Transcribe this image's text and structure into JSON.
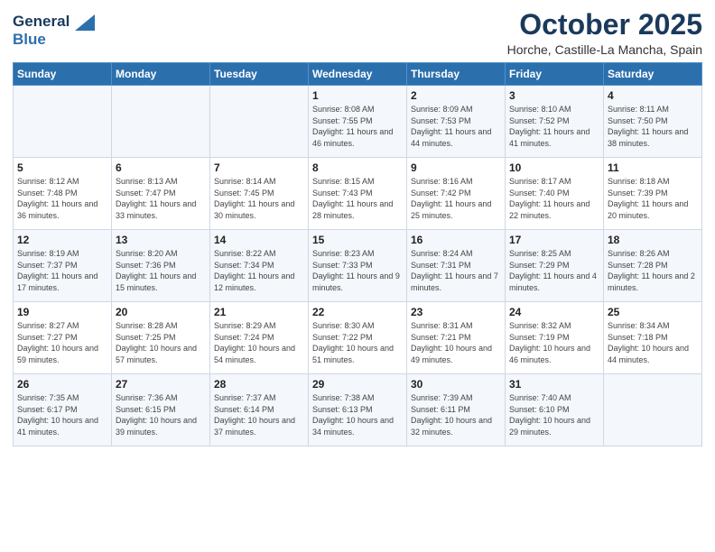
{
  "header": {
    "logo_line1": "General",
    "logo_line2": "Blue",
    "month": "October 2025",
    "location": "Horche, Castille-La Mancha, Spain"
  },
  "weekdays": [
    "Sunday",
    "Monday",
    "Tuesday",
    "Wednesday",
    "Thursday",
    "Friday",
    "Saturday"
  ],
  "weeks": [
    [
      {
        "day": "",
        "info": ""
      },
      {
        "day": "",
        "info": ""
      },
      {
        "day": "",
        "info": ""
      },
      {
        "day": "1",
        "info": "Sunrise: 8:08 AM\nSunset: 7:55 PM\nDaylight: 11 hours and 46 minutes."
      },
      {
        "day": "2",
        "info": "Sunrise: 8:09 AM\nSunset: 7:53 PM\nDaylight: 11 hours and 44 minutes."
      },
      {
        "day": "3",
        "info": "Sunrise: 8:10 AM\nSunset: 7:52 PM\nDaylight: 11 hours and 41 minutes."
      },
      {
        "day": "4",
        "info": "Sunrise: 8:11 AM\nSunset: 7:50 PM\nDaylight: 11 hours and 38 minutes."
      }
    ],
    [
      {
        "day": "5",
        "info": "Sunrise: 8:12 AM\nSunset: 7:48 PM\nDaylight: 11 hours and 36 minutes."
      },
      {
        "day": "6",
        "info": "Sunrise: 8:13 AM\nSunset: 7:47 PM\nDaylight: 11 hours and 33 minutes."
      },
      {
        "day": "7",
        "info": "Sunrise: 8:14 AM\nSunset: 7:45 PM\nDaylight: 11 hours and 30 minutes."
      },
      {
        "day": "8",
        "info": "Sunrise: 8:15 AM\nSunset: 7:43 PM\nDaylight: 11 hours and 28 minutes."
      },
      {
        "day": "9",
        "info": "Sunrise: 8:16 AM\nSunset: 7:42 PM\nDaylight: 11 hours and 25 minutes."
      },
      {
        "day": "10",
        "info": "Sunrise: 8:17 AM\nSunset: 7:40 PM\nDaylight: 11 hours and 22 minutes."
      },
      {
        "day": "11",
        "info": "Sunrise: 8:18 AM\nSunset: 7:39 PM\nDaylight: 11 hours and 20 minutes."
      }
    ],
    [
      {
        "day": "12",
        "info": "Sunrise: 8:19 AM\nSunset: 7:37 PM\nDaylight: 11 hours and 17 minutes."
      },
      {
        "day": "13",
        "info": "Sunrise: 8:20 AM\nSunset: 7:36 PM\nDaylight: 11 hours and 15 minutes."
      },
      {
        "day": "14",
        "info": "Sunrise: 8:22 AM\nSunset: 7:34 PM\nDaylight: 11 hours and 12 minutes."
      },
      {
        "day": "15",
        "info": "Sunrise: 8:23 AM\nSunset: 7:33 PM\nDaylight: 11 hours and 9 minutes."
      },
      {
        "day": "16",
        "info": "Sunrise: 8:24 AM\nSunset: 7:31 PM\nDaylight: 11 hours and 7 minutes."
      },
      {
        "day": "17",
        "info": "Sunrise: 8:25 AM\nSunset: 7:29 PM\nDaylight: 11 hours and 4 minutes."
      },
      {
        "day": "18",
        "info": "Sunrise: 8:26 AM\nSunset: 7:28 PM\nDaylight: 11 hours and 2 minutes."
      }
    ],
    [
      {
        "day": "19",
        "info": "Sunrise: 8:27 AM\nSunset: 7:27 PM\nDaylight: 10 hours and 59 minutes."
      },
      {
        "day": "20",
        "info": "Sunrise: 8:28 AM\nSunset: 7:25 PM\nDaylight: 10 hours and 57 minutes."
      },
      {
        "day": "21",
        "info": "Sunrise: 8:29 AM\nSunset: 7:24 PM\nDaylight: 10 hours and 54 minutes."
      },
      {
        "day": "22",
        "info": "Sunrise: 8:30 AM\nSunset: 7:22 PM\nDaylight: 10 hours and 51 minutes."
      },
      {
        "day": "23",
        "info": "Sunrise: 8:31 AM\nSunset: 7:21 PM\nDaylight: 10 hours and 49 minutes."
      },
      {
        "day": "24",
        "info": "Sunrise: 8:32 AM\nSunset: 7:19 PM\nDaylight: 10 hours and 46 minutes."
      },
      {
        "day": "25",
        "info": "Sunrise: 8:34 AM\nSunset: 7:18 PM\nDaylight: 10 hours and 44 minutes."
      }
    ],
    [
      {
        "day": "26",
        "info": "Sunrise: 7:35 AM\nSunset: 6:17 PM\nDaylight: 10 hours and 41 minutes."
      },
      {
        "day": "27",
        "info": "Sunrise: 7:36 AM\nSunset: 6:15 PM\nDaylight: 10 hours and 39 minutes."
      },
      {
        "day": "28",
        "info": "Sunrise: 7:37 AM\nSunset: 6:14 PM\nDaylight: 10 hours and 37 minutes."
      },
      {
        "day": "29",
        "info": "Sunrise: 7:38 AM\nSunset: 6:13 PM\nDaylight: 10 hours and 34 minutes."
      },
      {
        "day": "30",
        "info": "Sunrise: 7:39 AM\nSunset: 6:11 PM\nDaylight: 10 hours and 32 minutes."
      },
      {
        "day": "31",
        "info": "Sunrise: 7:40 AM\nSunset: 6:10 PM\nDaylight: 10 hours and 29 minutes."
      },
      {
        "day": "",
        "info": ""
      }
    ]
  ]
}
